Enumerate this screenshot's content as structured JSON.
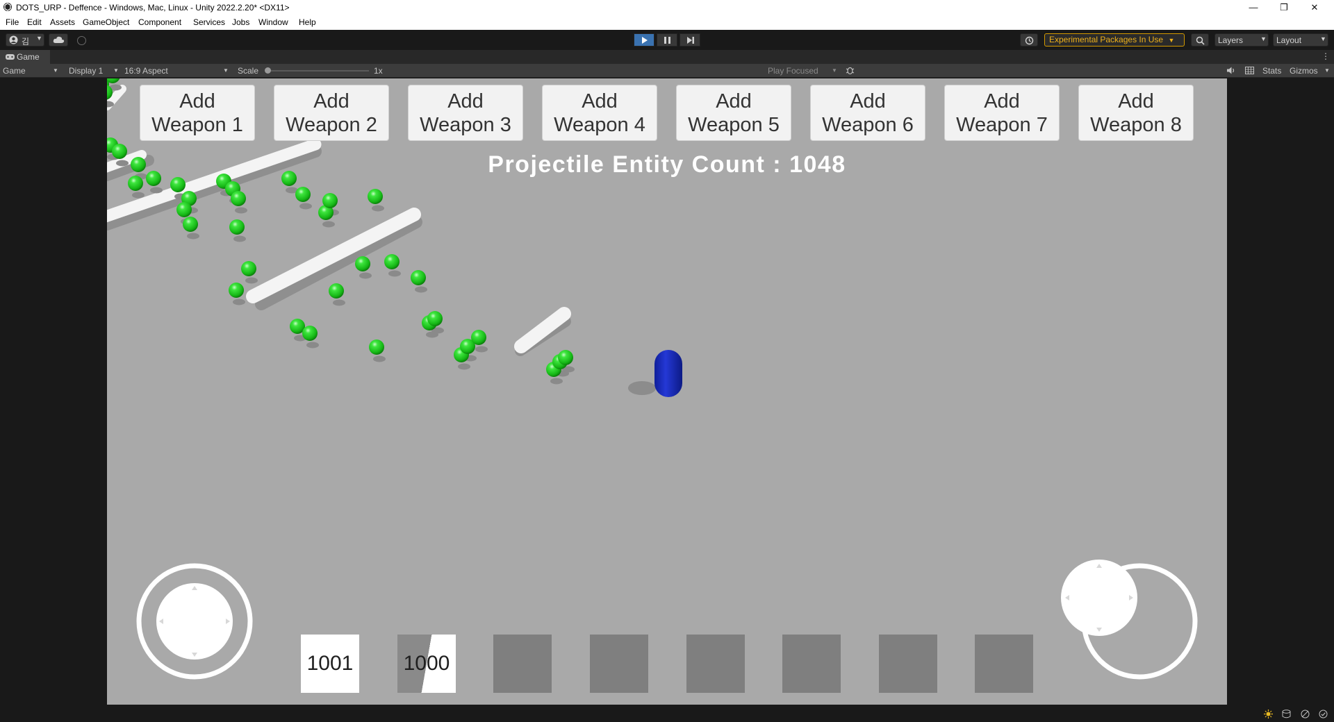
{
  "window": {
    "title": "DOTS_URP - Deffence - Windows, Mac, Linux - Unity 2022.2.20* <DX11>",
    "minimize_glyph": "—",
    "restore_glyph": "❐",
    "close_glyph": "✕"
  },
  "menu": [
    "File",
    "Edit",
    "Assets",
    "GameObject",
    "Component",
    "Services",
    "Jobs",
    "Window",
    "Help"
  ],
  "toolbar": {
    "account_label": "김",
    "experimental_label": "Experimental Packages In Use",
    "layers_label": "Layers",
    "layout_label": "Layout"
  },
  "game_tab": {
    "tab_label": "Game",
    "view_mode": "Game",
    "display": "Display 1",
    "aspect": "16:9 Aspect",
    "scale_label": "Scale",
    "scale_value": "1x",
    "play_mode": "Play Focused",
    "stats_label": "Stats",
    "gizmos_label": "Gizmos"
  },
  "game": {
    "weapon_buttons": [
      {
        "line1": "Add",
        "line2": "Weapon 1"
      },
      {
        "line1": "Add",
        "line2": "Weapon 2"
      },
      {
        "line1": "Add",
        "line2": "Weapon 3"
      },
      {
        "line1": "Add",
        "line2": "Weapon 4"
      },
      {
        "line1": "Add",
        "line2": "Weapon 5"
      },
      {
        "line1": "Add",
        "line2": "Weapon 6"
      },
      {
        "line1": "Add",
        "line2": "Weapon 7"
      },
      {
        "line1": "Add",
        "line2": "Weapon 8"
      }
    ],
    "entity_count_text": "Projectile Entity Count : 1048",
    "slots": [
      "1001",
      "1000",
      "",
      "",
      "",
      "",
      "",
      ""
    ],
    "colors": {
      "ground": "#a9a9a9",
      "projectile_green": "#1fd01f",
      "player_blue": "#1b2ec9",
      "trail_white": "#f2f2f2"
    }
  }
}
